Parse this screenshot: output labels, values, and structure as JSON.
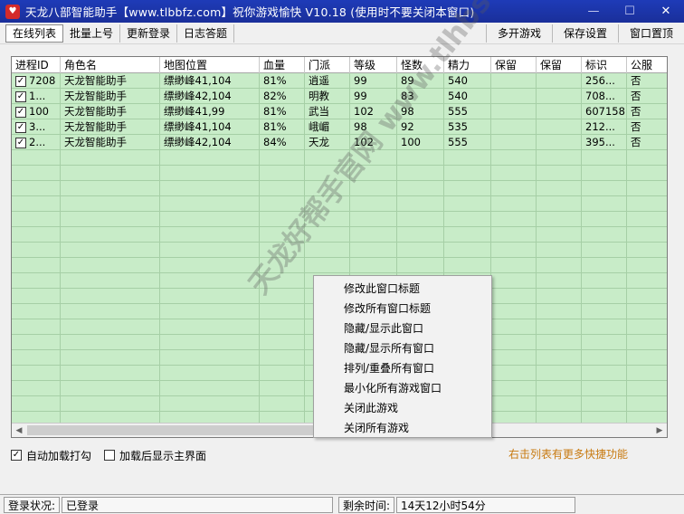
{
  "window": {
    "title": "天龙八部智能助手【www.tlbbfz.com】祝你游戏愉快 V10.18 (使用时不要关闭本窗口)",
    "close_glyph": "✕",
    "max_glyph": "☐",
    "min_glyph": "—"
  },
  "menubar": {
    "left": [
      "在线列表",
      "批量上号",
      "更新登录",
      "日志答题"
    ],
    "right": [
      "多开游戏",
      "保存设置",
      "窗口置顶"
    ]
  },
  "table": {
    "columns": [
      "进程ID",
      "角色名",
      "地图位置",
      "血量",
      "门派",
      "等级",
      "怪数",
      "精力",
      "保留",
      "保留",
      "标识",
      "公服"
    ],
    "rows": [
      [
        "7208",
        "天龙智能助手",
        "缥缈峰41,104",
        "81%",
        "逍遥",
        "99",
        "89",
        "540",
        "",
        "",
        "256...",
        "否"
      ],
      [
        "1...",
        "天龙智能助手",
        "缥缈峰42,104",
        "82%",
        "明教",
        "99",
        "83",
        "540",
        "",
        "",
        "708...",
        "否"
      ],
      [
        "100",
        "天龙智能助手",
        "缥缈峰41,99",
        "81%",
        "武当",
        "102",
        "98",
        "555",
        "",
        "",
        "607158",
        "否"
      ],
      [
        "3...",
        "天龙智能助手",
        "缥缈峰41,104",
        "81%",
        "峨嵋",
        "98",
        "92",
        "535",
        "",
        "",
        "212...",
        "否"
      ],
      [
        "2...",
        "天龙智能助手",
        "缥缈峰42,104",
        "84%",
        "天龙",
        "102",
        "100",
        "555",
        "",
        "",
        "395...",
        "否"
      ]
    ],
    "checked_glyph": "✓"
  },
  "watermark": {
    "text": "天龙好帮手官网 www.tlhbs.com"
  },
  "context_menu": {
    "items": [
      "修改此窗口标题",
      "修改所有窗口标题",
      "隐藏/显示此窗口",
      "隐藏/显示所有窗口",
      "排列/重叠所有窗口",
      "最小化所有游戏窗口",
      "关闭此游戏",
      "关闭所有游戏"
    ]
  },
  "options": {
    "auto_load_label": "自动加载打勾",
    "auto_load_checked": true,
    "show_main_label": "加载后显示主界面",
    "show_main_checked": false
  },
  "hint": "右击列表有更多快捷功能",
  "statusbar": {
    "login_label": "登录状况:",
    "login_value": "已登录",
    "remain_label": "剩余时间:",
    "remain_value": "14天12小时54分"
  },
  "colors": {
    "list_bg": "#c8ecc8",
    "title_bg": "#1e3bb8",
    "hint": "#c87a10"
  }
}
